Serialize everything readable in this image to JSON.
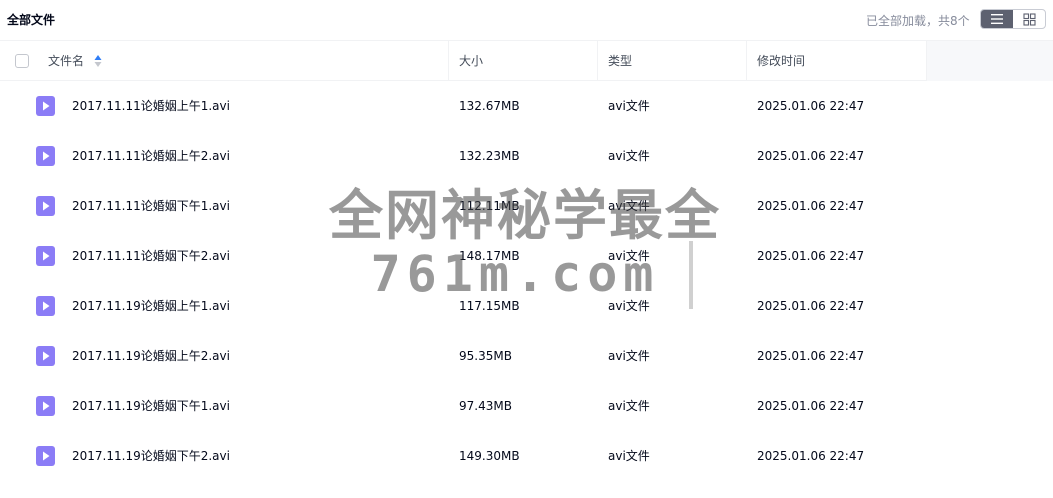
{
  "topbar": {
    "title": "全部文件",
    "loaded_text": "已全部加载，共8个",
    "view_list_icon": "list-icon",
    "view_grid_icon": "grid-icon"
  },
  "table": {
    "columns": [
      "文件名",
      "大小",
      "类型",
      "修改时间"
    ],
    "sort_icon": "sort-ascending-icon",
    "rows": [
      {
        "name": "2017.11.11论婚姻上午1.avi",
        "size": "132.67MB",
        "type": "avi文件",
        "modified": "2025.01.06 22:47"
      },
      {
        "name": "2017.11.11论婚姻上午2.avi",
        "size": "132.23MB",
        "type": "avi文件",
        "modified": "2025.01.06 22:47"
      },
      {
        "name": "2017.11.11论婚姻下午1.avi",
        "size": "112.11MB",
        "type": "avi文件",
        "modified": "2025.01.06 22:47"
      },
      {
        "name": "2017.11.11论婚姻下午2.avi",
        "size": "148.17MB",
        "type": "avi文件",
        "modified": "2025.01.06 22:47"
      },
      {
        "name": "2017.11.19论婚姻上午1.avi",
        "size": "117.15MB",
        "type": "avi文件",
        "modified": "2025.01.06 22:47"
      },
      {
        "name": "2017.11.19论婚姻上午2.avi",
        "size": "95.35MB",
        "type": "avi文件",
        "modified": "2025.01.06 22:47"
      },
      {
        "name": "2017.11.19论婚姻下午1.avi",
        "size": "97.43MB",
        "type": "avi文件",
        "modified": "2025.01.06 22:47"
      },
      {
        "name": "2017.11.19论婚姻下午2.avi",
        "size": "149.30MB",
        "type": "avi文件",
        "modified": "2025.01.06 22:47"
      }
    ]
  },
  "watermark": {
    "line1": "全网神秘学最全",
    "line2": "761m.com"
  },
  "colors": {
    "video_icon": "#8b7cf6",
    "sort_active": "#2f7df6",
    "header_text": "#454d5a",
    "muted_text": "#878c9c"
  }
}
